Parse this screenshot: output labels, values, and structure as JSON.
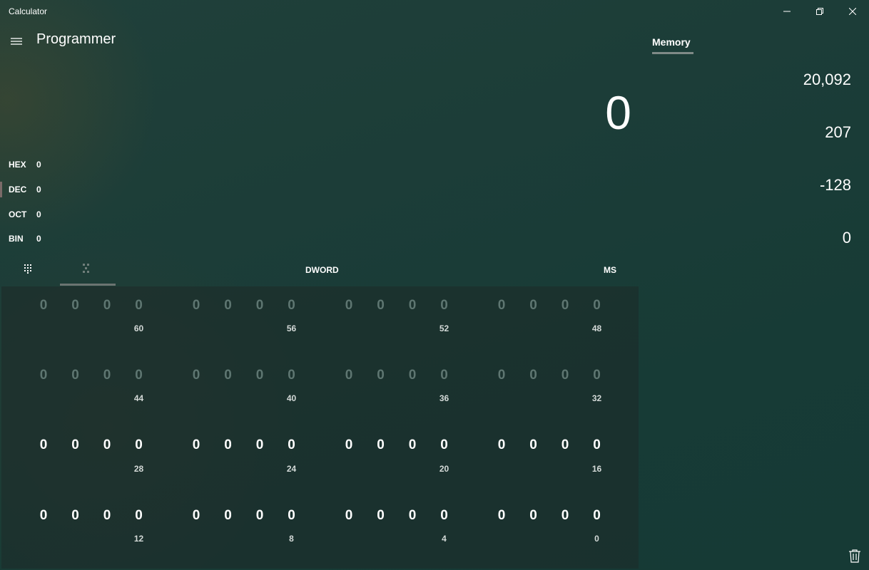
{
  "titlebar": {
    "app_title": "Calculator",
    "minimize_icon": "minimize-icon",
    "restore_icon": "restore-icon",
    "close_icon": "close-icon"
  },
  "header": {
    "menu_icon": "hamburger-icon",
    "mode_title": "Programmer"
  },
  "display": {
    "value": "0"
  },
  "radix": [
    {
      "label": "HEX",
      "value": "0",
      "selected": false
    },
    {
      "label": "DEC",
      "value": "0",
      "selected": true
    },
    {
      "label": "OCT",
      "value": "0",
      "selected": false
    },
    {
      "label": "BIN",
      "value": "0",
      "selected": false
    }
  ],
  "toolbar": {
    "keypad_icon": "keypad-icon",
    "bitflip_icon": "bit-toggle-icon",
    "word_size": "DWORD",
    "ms": "MS"
  },
  "bit_rows": [
    {
      "bits": [
        "0",
        "0",
        "0",
        "0",
        "0",
        "0",
        "0",
        "0",
        "0",
        "0",
        "0",
        "0",
        "0",
        "0",
        "0",
        "0"
      ],
      "positions": [
        "60",
        "56",
        "52",
        "48"
      ],
      "active": false
    },
    {
      "bits": [
        "0",
        "0",
        "0",
        "0",
        "0",
        "0",
        "0",
        "0",
        "0",
        "0",
        "0",
        "0",
        "0",
        "0",
        "0",
        "0"
      ],
      "positions": [
        "44",
        "40",
        "36",
        "32"
      ],
      "active": false
    },
    {
      "bits": [
        "0",
        "0",
        "0",
        "0",
        "0",
        "0",
        "0",
        "0",
        "0",
        "0",
        "0",
        "0",
        "0",
        "0",
        "0",
        "0"
      ],
      "positions": [
        "28",
        "24",
        "20",
        "16"
      ],
      "active": true
    },
    {
      "bits": [
        "0",
        "0",
        "0",
        "0",
        "0",
        "0",
        "0",
        "0",
        "0",
        "0",
        "0",
        "0",
        "0",
        "0",
        "0",
        "0"
      ],
      "positions": [
        "12",
        "8",
        "4",
        "0"
      ],
      "active": true
    }
  ],
  "memory": {
    "tab_label": "Memory",
    "items": [
      "20,092",
      "207",
      "-128",
      "0"
    ],
    "clear_icon": "trash-icon"
  },
  "colors": {
    "background": "#1c3d38",
    "dim_bit": "#5e7671",
    "active_bit": "#ffffff"
  }
}
